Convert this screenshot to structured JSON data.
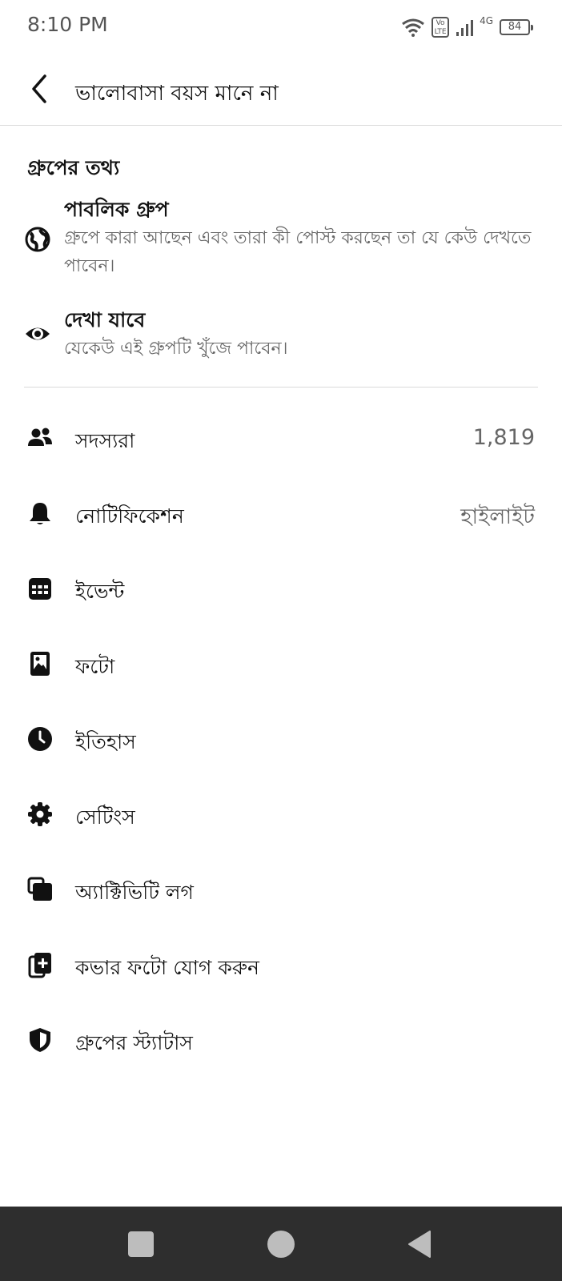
{
  "status_bar": {
    "time": "8:10 PM",
    "lte_line1": "Vo",
    "lte_line2": "LTE",
    "network_type": "4G",
    "battery": "84"
  },
  "header": {
    "title": "ভালোবাসা বয়স মানে না"
  },
  "group_info": {
    "section_title": "গ্রুপের তথ্য",
    "privacy": {
      "title": "পাবলিক গ্রুপ",
      "description": "গ্রুপে কারা আছেন এবং তারা কী পোস্ট করছেন তা যে কেউ দেখতে পাবেন।"
    },
    "visibility": {
      "title": "দেখা যাবে",
      "description": "যেকেউ এই গ্রুপটি খুঁজে পাবেন।"
    }
  },
  "menu": {
    "members": {
      "label": "সদস্যরা",
      "value": "1,819"
    },
    "notifications": {
      "label": "নোটিফিকেশন",
      "value": "হাইলাইট"
    },
    "events": {
      "label": "ইভেন্ট"
    },
    "photos": {
      "label": "ফটো"
    },
    "history": {
      "label": "ইতিহাস"
    },
    "settings": {
      "label": "সেটিংস"
    },
    "activity_log": {
      "label": "অ্যাক্টিভিটি লগ"
    },
    "add_cover_photo": {
      "label": "কভার ফটো যোগ করুন"
    },
    "group_status": {
      "label": "গ্রুপের স্ট্যাটাস"
    }
  },
  "icons": {
    "back": "chevron-left-icon",
    "privacy": "globe-icon",
    "visibility": "eye-icon",
    "members": "people-icon",
    "notifications": "bell-icon",
    "events": "calendar-icon",
    "photos": "photo-icon",
    "history": "clock-icon",
    "settings": "gear-icon",
    "activity_log": "activity-log-icon",
    "add_cover_photo": "add-photo-icon",
    "group_status": "shield-icon"
  },
  "colors": {
    "text_primary": "#111111",
    "text_secondary": "#666666",
    "divider": "#d9d9d9",
    "nav_bar": "#2e2e2e",
    "nav_buttons": "#bdbdbd"
  }
}
